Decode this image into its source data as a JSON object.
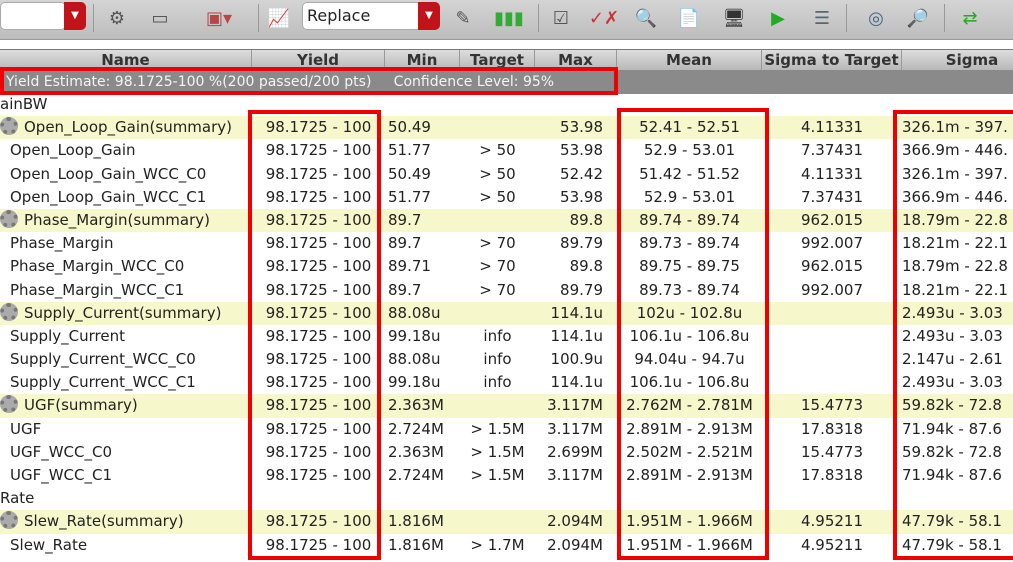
{
  "toolbar": {
    "mode_select": "Replace"
  },
  "header": {
    "columns": [
      "Name",
      "Yield",
      "Min",
      "Target",
      "Max",
      "Mean",
      "Sigma to Target",
      "Sigma"
    ]
  },
  "yield_estimate": "Yield Estimate: 98.1725-100 %(200 passed/200 pts)     Confidence Level: 95%",
  "rows": [
    {
      "type": "group",
      "name": "ainBW"
    },
    {
      "type": "summary",
      "name": "Open_Loop_Gain(summary)",
      "yield": "98.1725 - 100",
      "min": "50.49",
      "target": "",
      "max": "53.98",
      "mean": "52.41 - 52.51",
      "sigma_to_target": "4.11331",
      "sigma": "326.1m - 397."
    },
    {
      "type": "item",
      "name": "Open_Loop_Gain",
      "yield": "98.1725 - 100",
      "min": "51.77",
      "target": "> 50",
      "max": "53.98",
      "mean": "52.9 - 53.01",
      "sigma_to_target": "7.37431",
      "sigma": "366.9m - 446."
    },
    {
      "type": "item",
      "name": "Open_Loop_Gain_WCC_C0",
      "yield": "98.1725 - 100",
      "min": "50.49",
      "target": "> 50",
      "max": "52.42",
      "mean": "51.42 - 51.52",
      "sigma_to_target": "4.11331",
      "sigma": "326.1m - 397."
    },
    {
      "type": "item",
      "name": "Open_Loop_Gain_WCC_C1",
      "yield": "98.1725 - 100",
      "min": "51.77",
      "target": "> 50",
      "max": "53.98",
      "mean": "52.9 - 53.01",
      "sigma_to_target": "7.37431",
      "sigma": "366.9m - 446."
    },
    {
      "type": "summary",
      "name": "Phase_Margin(summary)",
      "yield": "98.1725 - 100",
      "min": "89.7",
      "target": "",
      "max": "89.8",
      "mean": "89.74 - 89.74",
      "sigma_to_target": "962.015",
      "sigma": "18.79m - 22.8"
    },
    {
      "type": "item",
      "name": "Phase_Margin",
      "yield": "98.1725 - 100",
      "min": "89.7",
      "target": "> 70",
      "max": "89.79",
      "mean": "89.73 - 89.74",
      "sigma_to_target": "992.007",
      "sigma": "18.21m - 22.1"
    },
    {
      "type": "item",
      "name": "Phase_Margin_WCC_C0",
      "yield": "98.1725 - 100",
      "min": "89.71",
      "target": "> 70",
      "max": "89.8",
      "mean": "89.75 - 89.75",
      "sigma_to_target": "962.015",
      "sigma": "18.79m - 22.8"
    },
    {
      "type": "item",
      "name": "Phase_Margin_WCC_C1",
      "yield": "98.1725 - 100",
      "min": "89.7",
      "target": "> 70",
      "max": "89.79",
      "mean": "89.73 - 89.74",
      "sigma_to_target": "992.007",
      "sigma": "18.21m - 22.1"
    },
    {
      "type": "summary",
      "name": "Supply_Current(summary)",
      "yield": "98.1725 - 100",
      "min": "88.08u",
      "target": "",
      "max": "114.1u",
      "mean": "102u - 102.8u",
      "sigma_to_target": "",
      "sigma": "2.493u - 3.03"
    },
    {
      "type": "item",
      "name": "Supply_Current",
      "yield": "98.1725 - 100",
      "min": "99.18u",
      "target": "info",
      "max": "114.1u",
      "mean": "106.1u - 106.8u",
      "sigma_to_target": "",
      "sigma": "2.493u - 3.03"
    },
    {
      "type": "item",
      "name": "Supply_Current_WCC_C0",
      "yield": "98.1725 - 100",
      "min": "88.08u",
      "target": "info",
      "max": "100.9u",
      "mean": "94.04u - 94.7u",
      "sigma_to_target": "",
      "sigma": "2.147u - 2.61"
    },
    {
      "type": "item",
      "name": "Supply_Current_WCC_C1",
      "yield": "98.1725 - 100",
      "min": "99.18u",
      "target": "info",
      "max": "114.1u",
      "mean": "106.1u - 106.8u",
      "sigma_to_target": "",
      "sigma": "2.493u - 3.03"
    },
    {
      "type": "summary",
      "name": "UGF(summary)",
      "yield": "98.1725 - 100",
      "min": "2.363M",
      "target": "",
      "max": "3.117M",
      "mean": "2.762M - 2.781M",
      "sigma_to_target": "15.4773",
      "sigma": "59.82k - 72.8"
    },
    {
      "type": "item",
      "name": "UGF",
      "yield": "98.1725 - 100",
      "min": "2.724M",
      "target": "> 1.5M",
      "max": "3.117M",
      "mean": "2.891M - 2.913M",
      "sigma_to_target": "17.8318",
      "sigma": "71.94k - 87.6"
    },
    {
      "type": "item",
      "name": "UGF_WCC_C0",
      "yield": "98.1725 - 100",
      "min": "2.363M",
      "target": "> 1.5M",
      "max": "2.699M",
      "mean": "2.502M - 2.521M",
      "sigma_to_target": "15.4773",
      "sigma": "59.82k - 72.8"
    },
    {
      "type": "item",
      "name": "UGF_WCC_C1",
      "yield": "98.1725 - 100",
      "min": "2.724M",
      "target": "> 1.5M",
      "max": "3.117M",
      "mean": "2.891M - 2.913M",
      "sigma_to_target": "17.8318",
      "sigma": "71.94k - 87.6"
    },
    {
      "type": "group",
      "name": "Rate"
    },
    {
      "type": "summary",
      "name": "Slew_Rate(summary)",
      "yield": "98.1725 - 100",
      "min": "1.816M",
      "target": "",
      "max": "2.094M",
      "mean": "1.951M - 1.966M",
      "sigma_to_target": "4.95211",
      "sigma": "47.79k - 58.1"
    },
    {
      "type": "item",
      "name": "Slew_Rate",
      "yield": "98.1725 - 100",
      "min": "1.816M",
      "target": "> 1.7M",
      "max": "2.094M",
      "mean": "1.951M - 1.966M",
      "sigma_to_target": "4.95211",
      "sigma": "47.79k - 58.1"
    }
  ]
}
